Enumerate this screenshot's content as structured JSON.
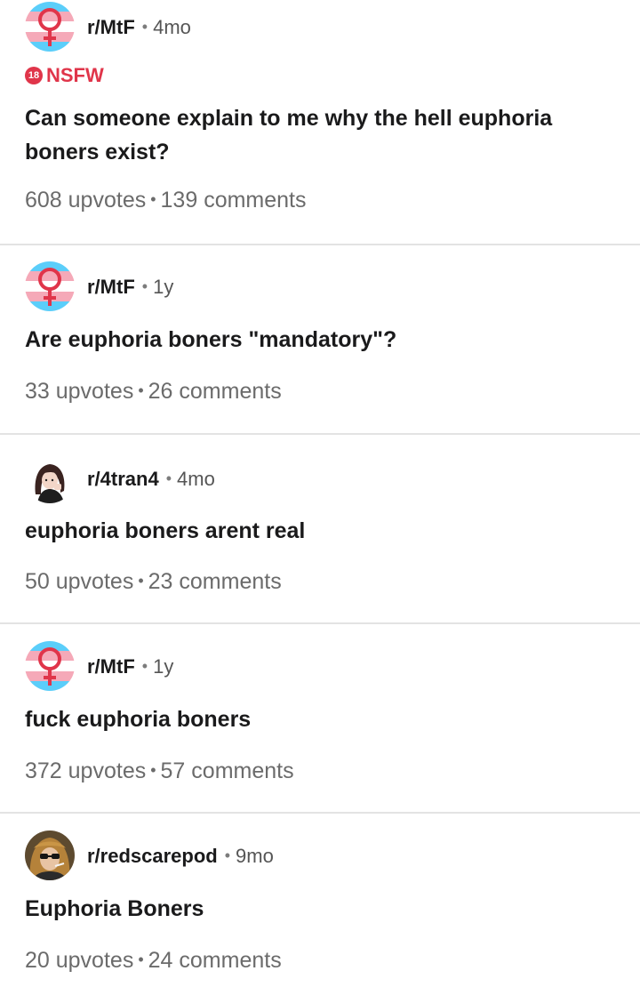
{
  "posts": [
    {
      "subreddit": "r/MtF",
      "age": "4mo",
      "avatar": "trans-flag-venus-icon",
      "nsfw_label": "NSFW",
      "nsfw_badge": "18",
      "title": "Can someone explain to me why the hell euphoria boners exist?",
      "upvotes": "608 upvotes",
      "comments": "139 comments"
    },
    {
      "subreddit": "r/MtF",
      "age": "1y",
      "avatar": "trans-flag-venus-icon",
      "title": "Are euphoria boners \"mandatory\"?",
      "upvotes": "33 upvotes",
      "comments": "26 comments"
    },
    {
      "subreddit": "r/4tran4",
      "age": "4mo",
      "avatar": "anime-girl-avatar",
      "title": "euphoria boners arent real",
      "upvotes": "50 upvotes",
      "comments": "23 comments"
    },
    {
      "subreddit": "r/MtF",
      "age": "1y",
      "avatar": "trans-flag-venus-icon",
      "title": "fuck euphoria boners",
      "upvotes": "372 upvotes",
      "comments": "57 comments"
    },
    {
      "subreddit": "r/redscarepod",
      "age": "9mo",
      "avatar": "portrait-photo-avatar",
      "title": "Euphoria Boners",
      "upvotes": "20 upvotes",
      "comments": "24 comments"
    }
  ],
  "separator": "•",
  "colors": {
    "nsfw": "#e0354a",
    "trans_blue": "#5bcefa",
    "trans_pink": "#f5a9b8",
    "divider": "#e3e3e3",
    "muted_text": "#6b6b6b"
  }
}
